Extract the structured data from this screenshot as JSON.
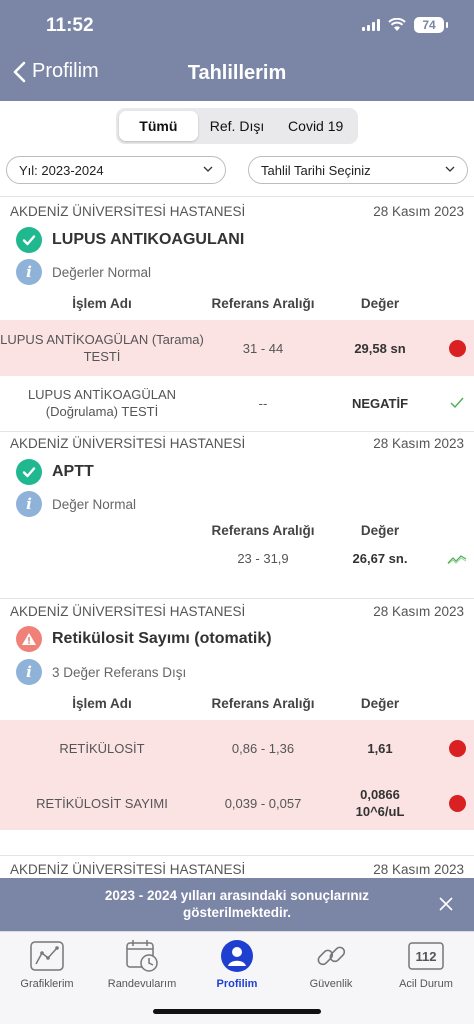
{
  "status": {
    "time": "11:52",
    "battery": "74"
  },
  "nav": {
    "back_label": "Profilim",
    "title": "Tahlillerim"
  },
  "segments": [
    "Tümü",
    "Ref. Dışı",
    "Covid 19"
  ],
  "filters": {
    "year": "Yıl: 2023-2024",
    "date": "Tahlil Tarihi Seçiniz"
  },
  "columns": {
    "name": "İşlem Adı",
    "range": "Referans Aralığı",
    "value": "Değer"
  },
  "cards": [
    {
      "hospital": "AKDENİZ ÜNİVERSİTESİ HASTANESİ",
      "date": "28 Kasım 2023",
      "title": "LUPUS ANTIKOAGULANI",
      "status_icon": "check-icon",
      "info": "Değerler Normal",
      "rows": [
        {
          "name": "LUPUS ANTİKOAGÜLAN (Tarama) TESTİ",
          "range": "31 - 44",
          "value": "29,58 sn",
          "flag": "out-of-range"
        },
        {
          "name": "LUPUS ANTİKOAGÜLAN (Doğrulama) TESTİ",
          "range": "--",
          "value": "NEGATİF",
          "flag": "normal"
        }
      ]
    },
    {
      "hospital": "AKDENİZ ÜNİVERSİTESİ HASTANESİ",
      "date": "28 Kasım 2023",
      "title": "APTT",
      "status_icon": "check-icon",
      "info": "Değer Normal",
      "rows": [
        {
          "name": "",
          "range": "23 - 31,9",
          "value": "26,67 sn.",
          "flag": "trend"
        }
      ]
    },
    {
      "hospital": "AKDENİZ ÜNİVERSİTESİ HASTANESİ",
      "date": "28 Kasım 2023",
      "title": "Retikülosit Sayımı (otomatik)",
      "status_icon": "warning-icon",
      "info": "3 Değer Referans Dışı",
      "rows": [
        {
          "name": "RETİKÜLOSİT",
          "range": "0,86 - 1,36",
          "value": "1,61",
          "flag": "out-of-range"
        },
        {
          "name": "RETİKÜLOSİT SAYIMI",
          "range": "0,039 - 0,057",
          "value": "0,0866 10^6/uL",
          "flag": "out-of-range"
        }
      ]
    },
    {
      "hospital": "AKDENİZ ÜNİVERSİTESİ HASTANESİ",
      "date": "28 Kasım 2023"
    }
  ],
  "banner": {
    "text": "2023 - 2024 yılları arasındaki sonuçlarınız gösterilmektedir."
  },
  "tabs": [
    {
      "label": "Grafiklerim",
      "icon": "chart-icon"
    },
    {
      "label": "Randevularım",
      "icon": "calendar-icon"
    },
    {
      "label": "Profilim",
      "icon": "profile-icon",
      "active": true
    },
    {
      "label": "Güvenlik",
      "icon": "link-icon"
    },
    {
      "label": "Acil Durum",
      "icon": "emergency-112-icon",
      "icon_text": "112"
    }
  ],
  "colors": {
    "header": "#7b86a7",
    "accent": "#1f3fd1",
    "alert": "#d92121",
    "alert_bg": "#fbe3e4",
    "ok": "#1fb88f"
  }
}
